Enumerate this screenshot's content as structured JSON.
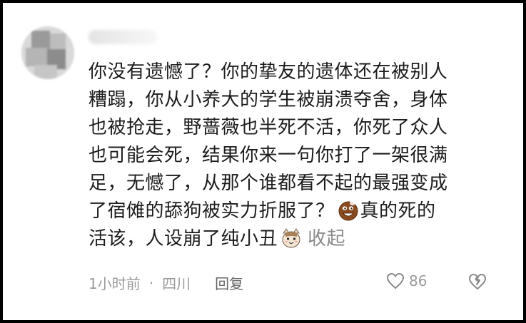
{
  "comment": {
    "lines": [
      "你没有遗憾了？你的挚友的遗体还在被别人",
      "糟蹋，你从小养大的学生被崩溃夺舍，身体",
      "也被抢走，野蔷薇也半死不活，你死了众人",
      "也可能会死，结果你来一句你打了一架很满",
      "足，无憾了，从那个谁都看不起的最强变成",
      "了宿傩的舔狗被实力折服了？"
    ],
    "line6_tail": "真的死的",
    "line7": "活该，人设崩了纯小丑",
    "collapse_label": "收起",
    "emoji_1": "brown-laughing-emoji-icon",
    "emoji_2": "cat-emoji-icon"
  },
  "meta": {
    "time": "1小时前",
    "separator": "·",
    "location": "四川",
    "reply_label": "回复"
  },
  "actions": {
    "like_count": "86",
    "like_icon": "heart-icon",
    "dislike_icon": "broken-heart-icon"
  }
}
